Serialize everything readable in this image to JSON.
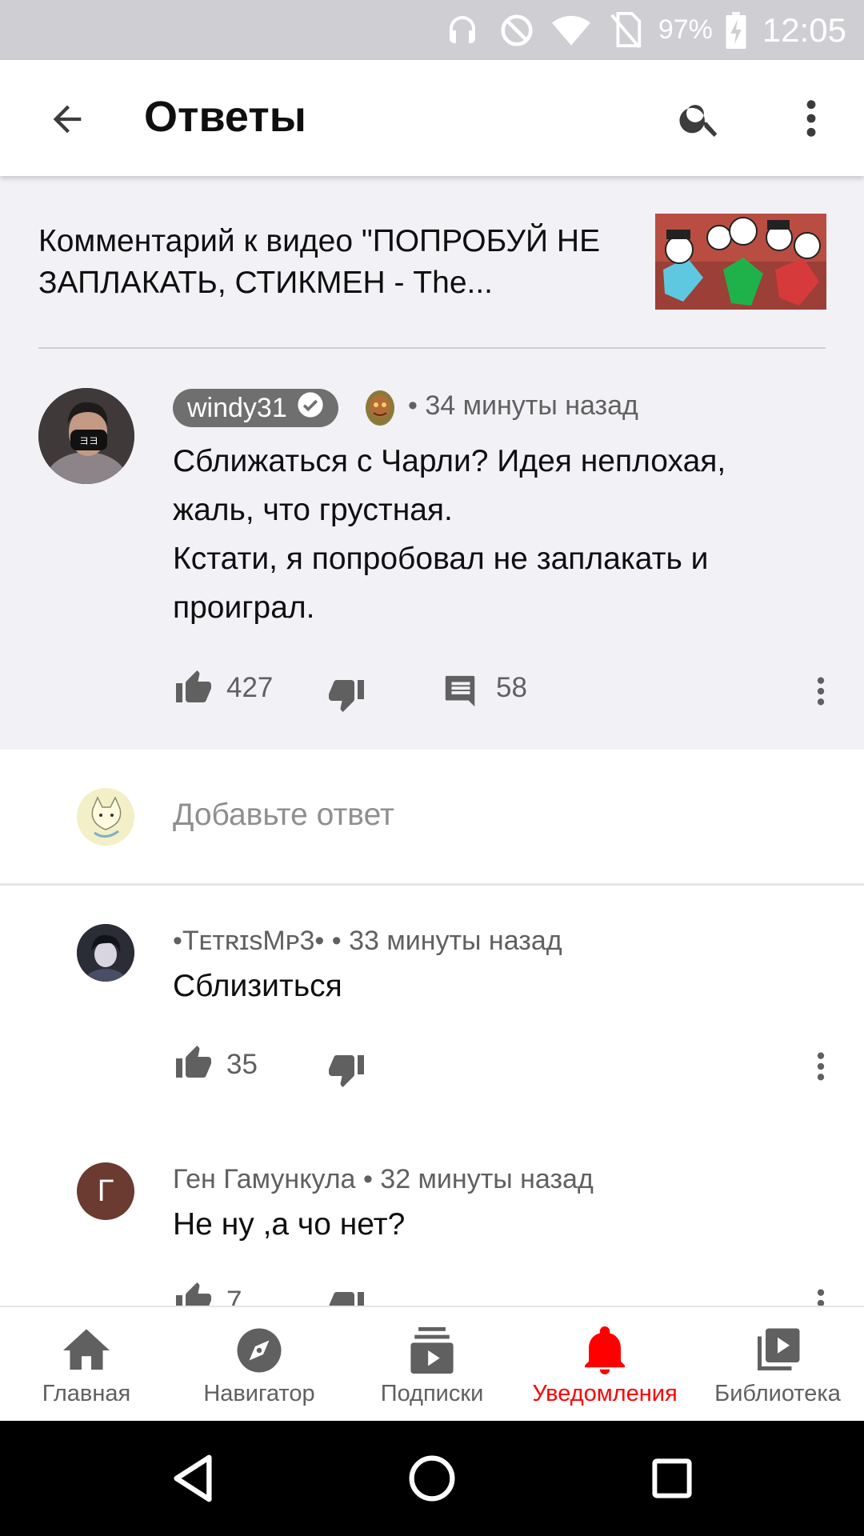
{
  "status_bar": {
    "battery": "97%",
    "time": "12:05"
  },
  "app_bar": {
    "title": "Ответы",
    "icons": [
      "back-arrow-icon",
      "search-icon",
      "more-vert-icon"
    ]
  },
  "context": {
    "text": "Комментарий к видео \"ПОПРОБУЙ НЕ ЗАПЛАКАТЬ, СТИКМЕН - The..."
  },
  "parent_comment": {
    "author": "windy31",
    "time": "• 34 минуты назад",
    "lines": [
      "Сближаться с Чарли? Идея неплохая,",
      "жаль, что грустная.",
      "Кстати, я попробовал не заплакать и",
      "проиграл."
    ],
    "likes": "427",
    "replies": "58"
  },
  "add_reply": {
    "placeholder": "Добавьте ответ"
  },
  "replies": [
    {
      "author": "•TᴇᴛʀɪsMᴘ3•",
      "time": "• 33 минуты назад",
      "text": "Сблизиться",
      "likes": "35"
    },
    {
      "author": "Ген Гамункула",
      "avatar_letter": "Г",
      "time": "• 32 минуты назад",
      "text": "Не ну ,а чо нет?",
      "likes": "7"
    }
  ],
  "bottom_nav": [
    {
      "label": "Главная",
      "icon": "home-icon"
    },
    {
      "label": "Навигатор",
      "icon": "compass-icon"
    },
    {
      "label": "Подписки",
      "icon": "subscriptions-icon"
    },
    {
      "label": "Уведомления",
      "icon": "bell-icon",
      "active": true
    },
    {
      "label": "Библиотека",
      "icon": "library-icon"
    }
  ],
  "colors": {
    "accent": "#ff0000",
    "secondary_text": "#606060",
    "parent_bg": "#f2f1f6"
  }
}
